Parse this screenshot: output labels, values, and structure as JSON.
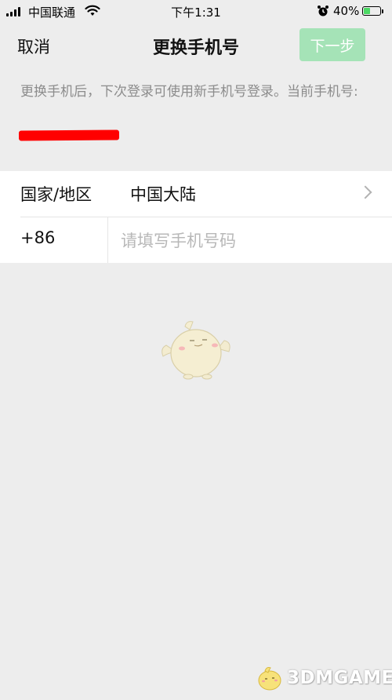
{
  "status_bar": {
    "carrier": "中国联通",
    "time": "下午1:31",
    "battery_percent": "40%",
    "battery_level": 0.4,
    "icons": [
      "signal-icon",
      "wifi-icon",
      "alarm-icon",
      "battery-icon"
    ]
  },
  "nav": {
    "cancel_label": "取消",
    "title": "更换手机号",
    "next_label": "下一步",
    "next_enabled": false
  },
  "description": "更换手机后，下次登录可使用新手机号登录。当前手机号:",
  "form": {
    "region_label": "国家/地区",
    "region_value": "中国大陆",
    "country_code": "+86",
    "phone_placeholder": "请填写手机号码",
    "phone_value": ""
  },
  "watermark": {
    "text": "3DMGAME"
  },
  "colors": {
    "background": "#ededed",
    "accent_disabled": "#a5e3b7",
    "redaction": "#ff0000",
    "hint_text": "#8c8c8c",
    "placeholder": "#b8b8b8"
  }
}
